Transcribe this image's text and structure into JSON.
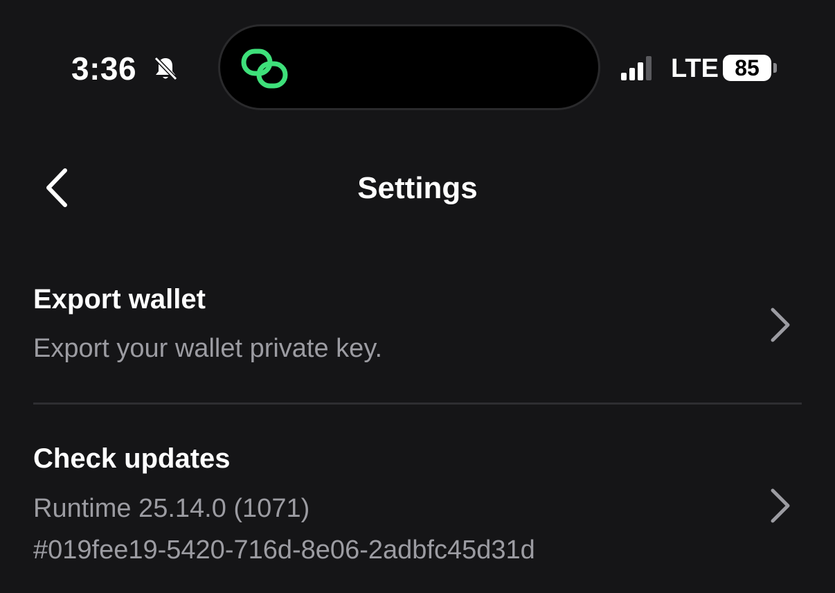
{
  "status_bar": {
    "time": "3:36",
    "network": "LTE",
    "battery": "85",
    "icons": [
      "bell-slash-icon",
      "app-link-icon",
      "signal-icon"
    ]
  },
  "colors": {
    "background": "#151517",
    "accent_green": "#3ee07a",
    "secondary_text": "#9c9ca2"
  },
  "header": {
    "title": "Settings"
  },
  "settings": {
    "items": [
      {
        "title": "Export wallet",
        "subtitle": "Export your wallet private key."
      },
      {
        "title": "Check updates",
        "subtitle": "Runtime 25.14.0 (1071)",
        "subtitle2": "#019fee19-5420-716d-8e06-2adbfc45d31d"
      }
    ]
  }
}
